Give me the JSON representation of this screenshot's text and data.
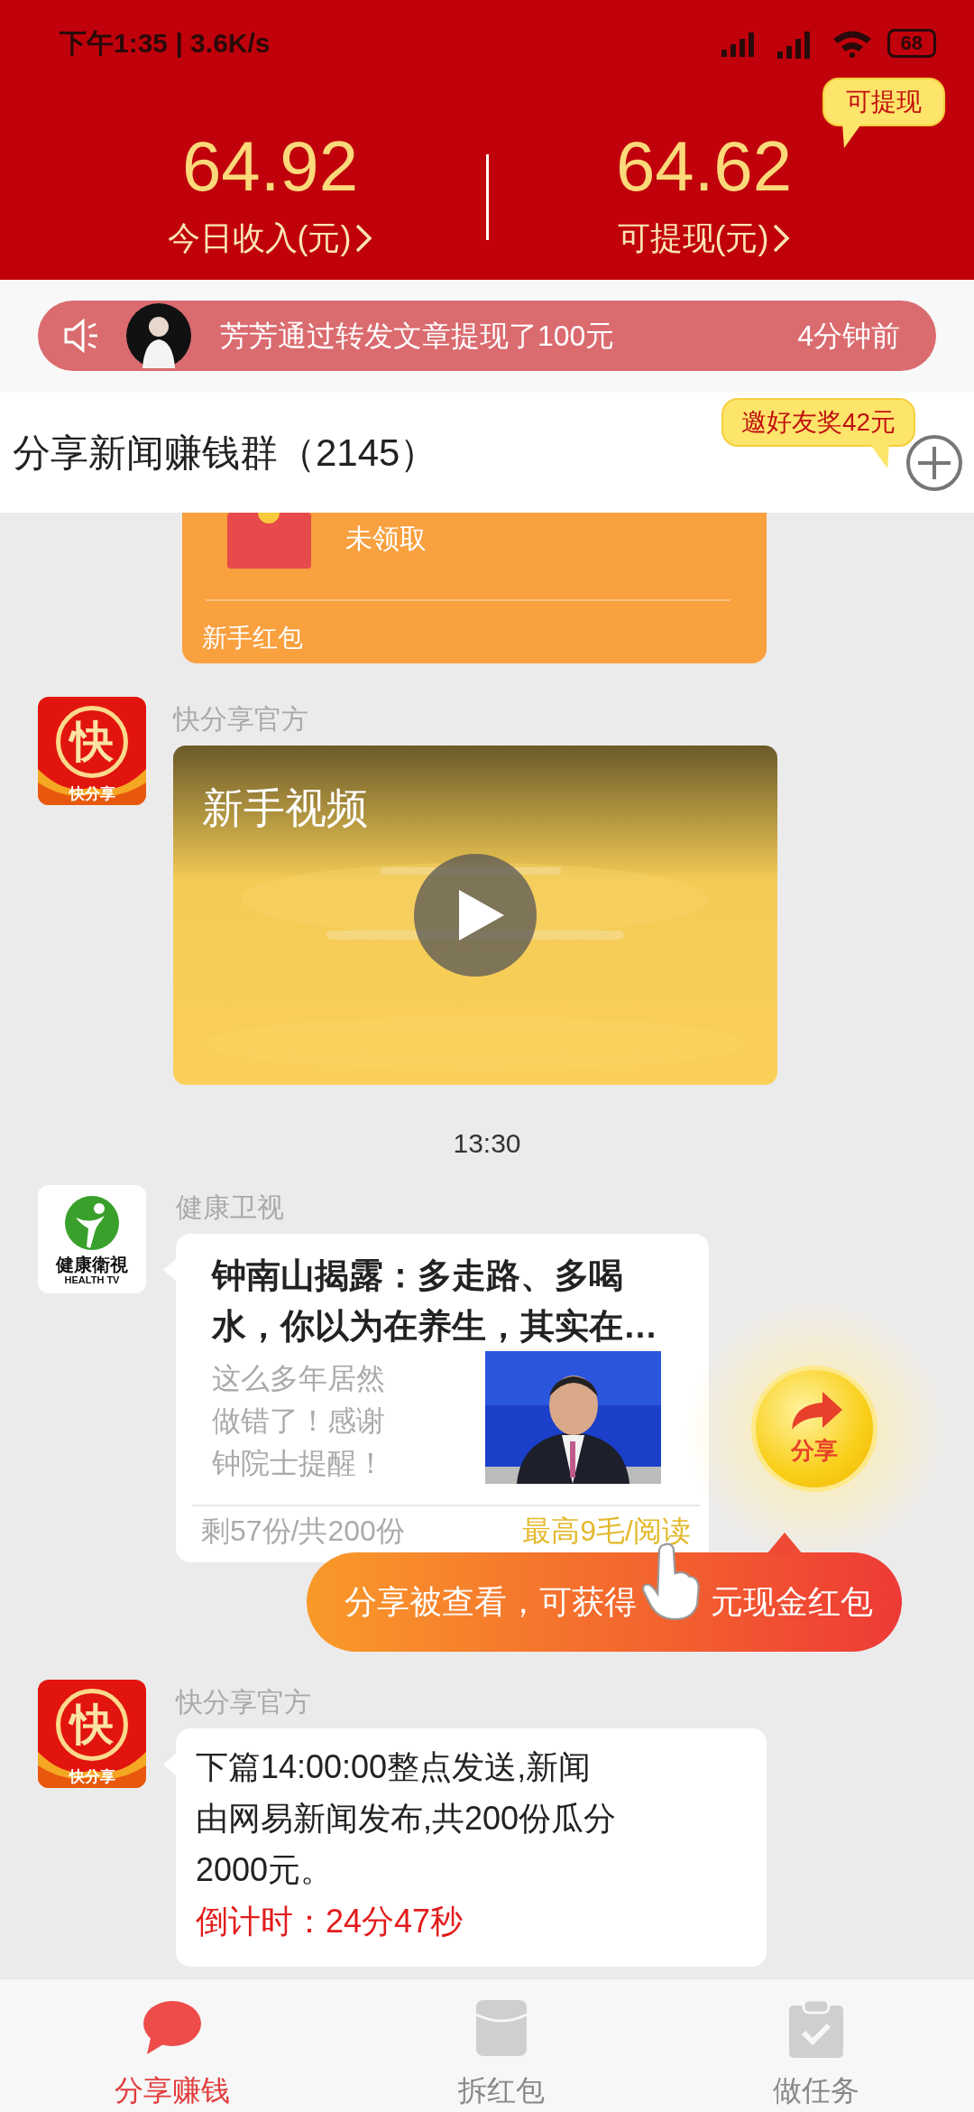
{
  "status_bar": {
    "time_speed": "下午1:35 | 3.6K/s",
    "battery": "68"
  },
  "earnings": [
    {
      "amount": "64.92",
      "label": "今日收入(元)"
    },
    {
      "amount": "64.62",
      "label": "可提现(元)"
    }
  ],
  "withdraw_tip": "可提现",
  "notice": {
    "text": "芳芳通过转发文章提现了100元",
    "time": "4分钟前"
  },
  "group": {
    "title": "分享新闻赚钱群（2145）",
    "invite_tip": "邀好友奖42元"
  },
  "messages": [
    {
      "kind": "red_packet",
      "status": "未领取",
      "footer": "新手红包"
    },
    {
      "kind": "video",
      "sender": "快分享官方",
      "avatar": {
        "kind": "kuai",
        "glyph": "快",
        "caption": "快分享"
      },
      "title": "新手视频"
    },
    {
      "kind": "time",
      "text": "13:30"
    },
    {
      "kind": "article",
      "sender": "健康卫视",
      "avatar": {
        "kind": "health",
        "caption": "健康衛視",
        "caption_en": "HEALTH TV"
      },
      "title": "钟南山揭露：多走路、多喝水，你以为在养生，其实在…",
      "excerpt": "这么多年居然做错了！感谢钟院士提醒！",
      "remaining": "剩57份/共200份",
      "reward": "最高9毛/阅读"
    },
    {
      "kind": "text",
      "sender": "快分享官方",
      "avatar": {
        "kind": "kuai",
        "glyph": "快",
        "caption": "快分享"
      },
      "text": "下篇14:00:00整点发送,新闻由网易新闻发布,共200份瓜分2000元。",
      "countdown": "倒计时：24分47秒"
    }
  ],
  "share_button": {
    "label": "分享"
  },
  "share_banner": {
    "before": "分享被查看，可获得",
    "after": "元现金红包"
  },
  "tabs": [
    {
      "label": "分享赚钱",
      "selected": true
    },
    {
      "label": "拆红包",
      "selected": false
    },
    {
      "label": "做任务",
      "selected": false
    }
  ]
}
